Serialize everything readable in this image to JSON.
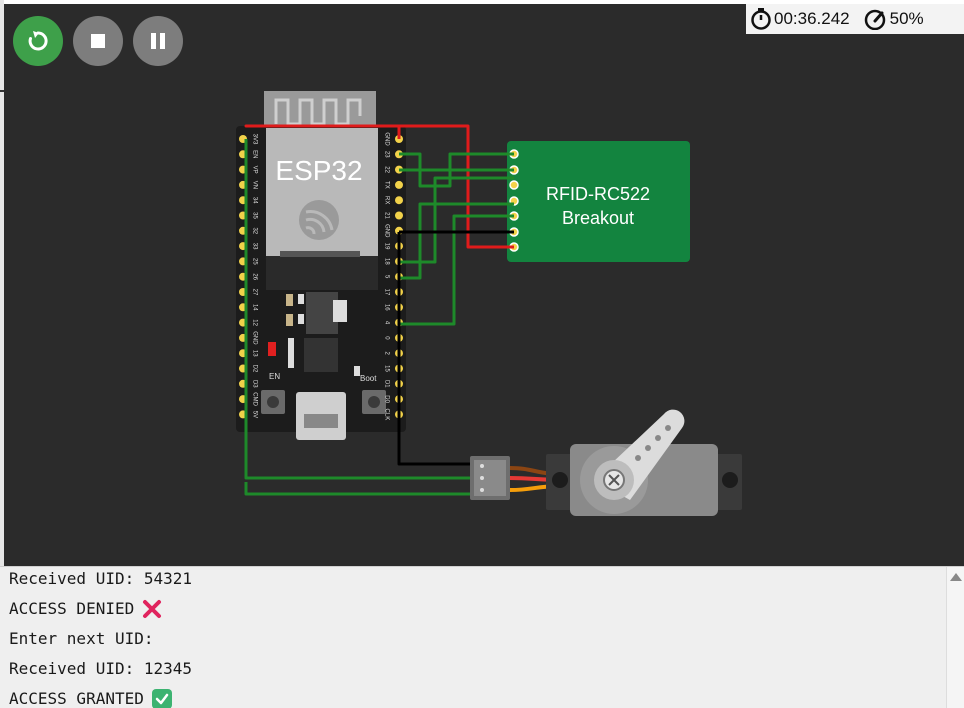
{
  "toolbar": {
    "restart_icon": "restart-icon",
    "stop_icon": "stop-icon",
    "pause_icon": "pause-icon"
  },
  "status": {
    "timer": "00:36.242",
    "speed": "50%",
    "timer_icon": "stopwatch-icon",
    "speed_icon": "speedometer-icon"
  },
  "board": {
    "label": "ESP32",
    "left_pins": [
      "3V3",
      "EN",
      "VP",
      "VN",
      "34",
      "35",
      "32",
      "33",
      "25",
      "26",
      "27",
      "14",
      "12",
      "GND",
      "13",
      "D2",
      "D3",
      "CMD",
      "5V"
    ],
    "right_pins": [
      "GND",
      "23",
      "22",
      "TX",
      "RX",
      "21",
      "GND",
      "19",
      "18",
      "5",
      "17",
      "16",
      "4",
      "0",
      "2",
      "15",
      "D1",
      "D0",
      "CLK"
    ],
    "en_label": "EN",
    "boot_label": "Boot"
  },
  "rfid": {
    "line1": "RFID-RC522",
    "line2": "Breakout"
  },
  "colors": {
    "canvas": "#2b2b2b",
    "wire_red": "#e01b1b",
    "wire_green": "#1e8a2a",
    "wire_black": "#000000",
    "rfid_board": "#13843f",
    "esp_board": "#1c1c1c",
    "run_button": "#3ea04a"
  },
  "serial": {
    "lines": [
      {
        "text": "Received UID: 54321",
        "emoji": ""
      },
      {
        "text": "ACCESS DENIED",
        "emoji": "cross-mark-icon"
      },
      {
        "text": "Enter next UID:",
        "emoji": ""
      },
      {
        "text": "Received UID: 12345",
        "emoji": ""
      },
      {
        "text": "ACCESS GRANTED",
        "emoji": "check-mark-icon"
      }
    ]
  }
}
